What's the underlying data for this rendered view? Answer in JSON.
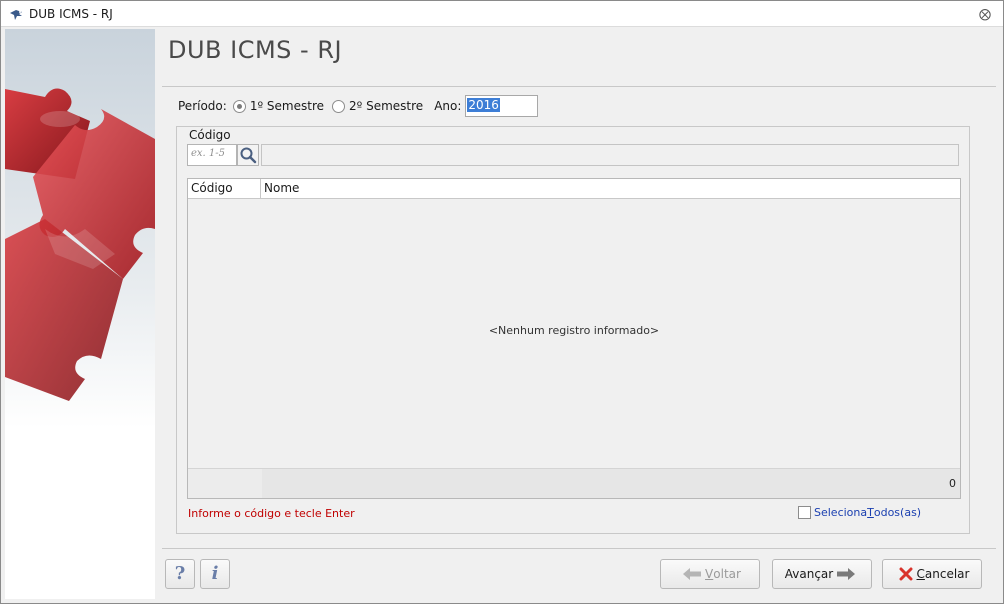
{
  "window": {
    "title": "DUB ICMS - RJ",
    "close_glyph": "⨂"
  },
  "page": {
    "heading": "DUB ICMS - RJ"
  },
  "period": {
    "label": "Período:",
    "options": [
      "1º Semestre",
      "2º Semestre"
    ],
    "selected": "1º Semestre",
    "year_label": "Ano:",
    "year_value": "2016"
  },
  "filter": {
    "legend": "Código",
    "code_placeholder": "ex. 1-5",
    "name_value": ""
  },
  "table": {
    "columns": [
      "Código",
      "Nome"
    ],
    "rows": [],
    "empty_message": "<Nenhum registro informado>",
    "count": "0"
  },
  "hint": "Informe o código e tecle Enter",
  "select_all": {
    "prefix": "Seleciona ",
    "underlined": "T",
    "suffix": "odos(as)",
    "checked": false
  },
  "footer": {
    "help_label": "?",
    "info_label": "i",
    "back_prefix": "",
    "back_underlined": "V",
    "back_suffix": "oltar",
    "next_label": "Avançar",
    "cancel_underlined": "C",
    "cancel_suffix": "ancelar"
  },
  "colors": {
    "accent_selection": "#3d7ed6",
    "hint_red": "#c00000",
    "link_blue": "#1a3fb0",
    "puzzle_red": "#b3141b",
    "cancel_icon_red": "#d9332b",
    "arrow_grey": "#7a7a7a"
  },
  "icons": {
    "app": "bird-app-icon",
    "close": "close-icon",
    "search": "search-icon",
    "back": "arrow-left-icon",
    "next": "arrow-right-icon",
    "cancel": "x-cancel-icon"
  }
}
